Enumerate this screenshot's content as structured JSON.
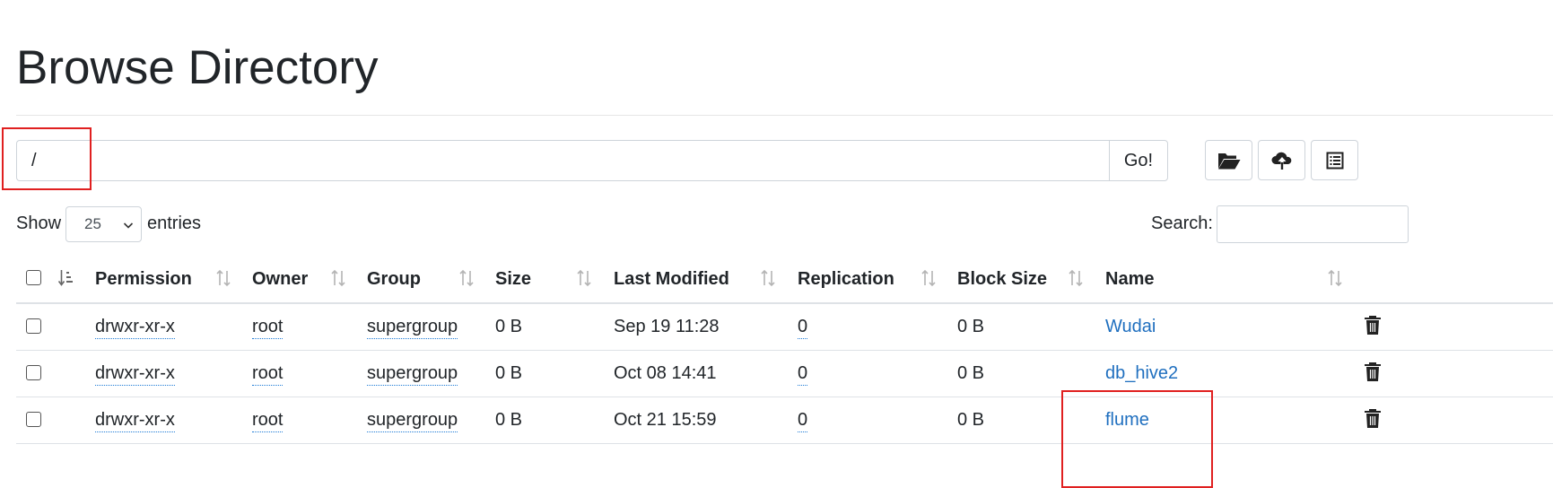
{
  "page_title": "Browse Directory",
  "path_input": {
    "value": "/"
  },
  "go_button_label": "Go!",
  "toolbar": {
    "icons": [
      "folder-open-icon",
      "upload-cloud-icon",
      "list-icon"
    ]
  },
  "length_control": {
    "show_label": "Show",
    "page_size": "25",
    "entries_label": "entries"
  },
  "search": {
    "label": "Search:",
    "value": ""
  },
  "table": {
    "columns": [
      "Permission",
      "Owner",
      "Group",
      "Size",
      "Last Modified",
      "Replication",
      "Block Size",
      "Name"
    ],
    "rows": [
      {
        "permission": "drwxr-xr-x",
        "owner": "root",
        "group": "supergroup",
        "size": "0 B",
        "last_modified": "Sep 19 11:28",
        "replication": "0",
        "block_size": "0 B",
        "name": "Wudai"
      },
      {
        "permission": "drwxr-xr-x",
        "owner": "root",
        "group": "supergroup",
        "size": "0 B",
        "last_modified": "Oct 08 14:41",
        "replication": "0",
        "block_size": "0 B",
        "name": "db_hive2"
      },
      {
        "permission": "drwxr-xr-x",
        "owner": "root",
        "group": "supergroup",
        "size": "0 B",
        "last_modified": "Oct 21 15:59",
        "replication": "0",
        "block_size": "0 B",
        "name": "flume"
      }
    ]
  },
  "colors": {
    "link": "#1f6fbf",
    "highlight": "#e02020",
    "border": "#ced4da"
  }
}
